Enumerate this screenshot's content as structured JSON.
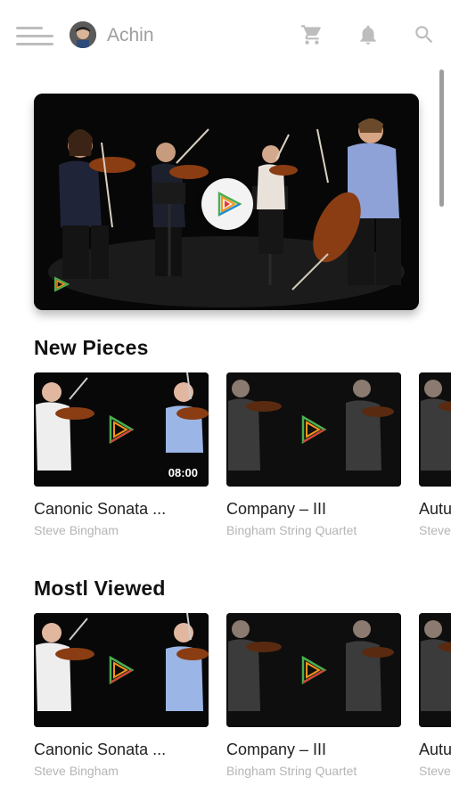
{
  "header": {
    "user_name": "Achin",
    "menu_icon": "hamburger-menu-icon",
    "cart_icon": "cart-icon",
    "notification_icon": "bell-icon",
    "search_icon": "search-icon",
    "icon_color": "#bdbdbd"
  },
  "hero": {
    "play_icon": "play-icon"
  },
  "sections": [
    {
      "title": "New Pieces",
      "items": [
        {
          "title": "Canonic Sonata ...",
          "subtitle": "Steve Bingham",
          "duration": "08:00"
        },
        {
          "title": "Company – III",
          "subtitle": "Bingham String Quartet"
        },
        {
          "title": "Autu",
          "subtitle": "Steve"
        }
      ]
    },
    {
      "title": "Mostl Viewed",
      "items": [
        {
          "title": "Canonic Sonata ...",
          "subtitle": "Steve Bingham"
        },
        {
          "title": "Company – III",
          "subtitle": "Bingham String Quartet"
        },
        {
          "title": "Autu",
          "subtitle": "Steve"
        }
      ]
    }
  ],
  "colors": {
    "play_triangle_green": "#4caf50",
    "play_triangle_orange": "#f7941d",
    "play_triangle_red": "#e53935",
    "play_triangle_blue": "#1e88e5"
  }
}
